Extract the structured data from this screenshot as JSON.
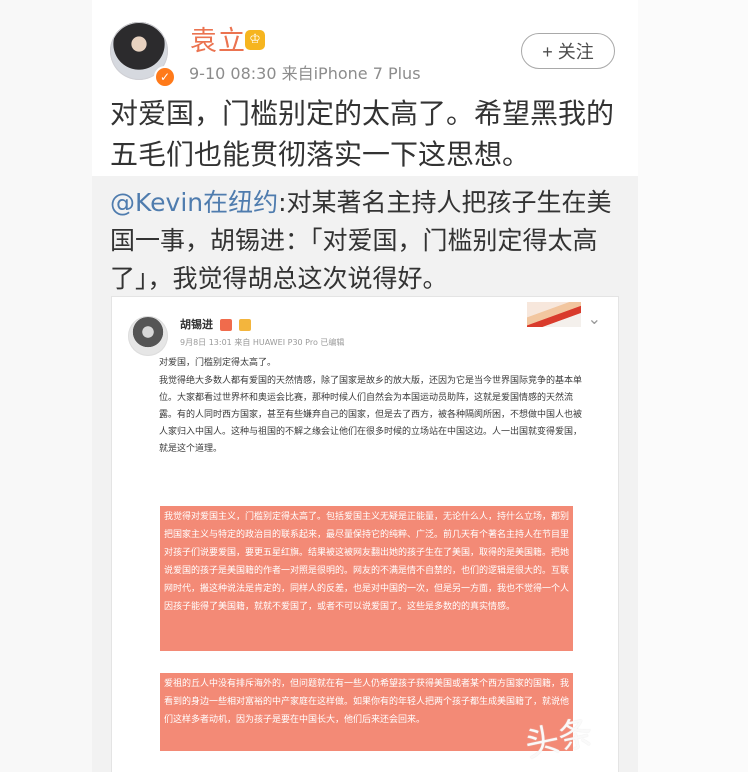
{
  "post": {
    "author": {
      "name": "袁立",
      "avatar_icon": "user-avatar",
      "verified_icon": "verified-badge-icon",
      "vip_icon": "crown-icon"
    },
    "meta": "9-10 08:30  来自iPhone 7 Plus",
    "follow_label": "+ 关注",
    "text": "对爱国，门槛别定的太高了。希望黑我的五毛们也能贯彻落实一下这思想。"
  },
  "retweet": {
    "mention": "@Kevin在纽约",
    "text": ":对某著名主持人把孩子生在美国一事，胡锡进：「对爱国，门槛别定得太高了」，我觉得胡总这次说得好。"
  },
  "embedded_screenshot": {
    "author": "胡锡进",
    "meta": "9月8日 13:01 来自 HUAWEI P30 Pro  已编辑",
    "line_1": "对爱国，门槛别定得太高了。",
    "paragraph_1": "我觉得绝大多数人都有爱国的天然情感，除了国家是故乡的放大版，还因为它是当今世界国际竞争的基本单位。大家都看过世界杯和奥运会比赛，那种时候人们自然会为本国运动员助阵，这就是爱国情感的天然流露。有的人同时西方国家，甚至有些嫌弃自己的国家，但是去了西方，被各种隔阂所困，不想做中国人也被人家归入中国人。这种与祖国的不解之缘会让他们在很多时候的立场站在中国这边。人一出国就变得爱国，就是这个道理。",
    "highlight_1": "我觉得对爱国主义，门槛别定得太高了。包括爱国主义无疑是正能量，无论什么人，持什么立场，都别把国家主义与特定的政治目的联系起来，最尽量保持它的纯粹、广泛。前几天有个著名主持人在节目里对孩子们说要爱国，要更五星红旗。结果被这被网友翻出她的孩子生在了美国，取得的是美国籍。把她说爱国的孩子是美国籍的作者一对照是很明的。网友的不满是情不自禁的，也们的逻辑是很大的。互联网时代，搬这种说法是肯定的，同样人的反差，也是对中国的一次，但是另一方面，我也不觉得一个人因孩子能得了美国籍，就就不爱国了，或者不可以说爱国了。这些是多数的的真实情感。",
    "highlight_2": "爱祖的丘人中没有排斥海外的，但问题就在有一些人仍希望孩子获得美国或者某个西方国家的国籍，我看到的身边一些相对富裕的中产家庭在这样做。如果你有的年轻人把两个孩子都生成美国籍了，就说他们这样多者动机，因为孩子是要在中国长大，他们后来还会回来。"
  },
  "watermark": "头条"
}
